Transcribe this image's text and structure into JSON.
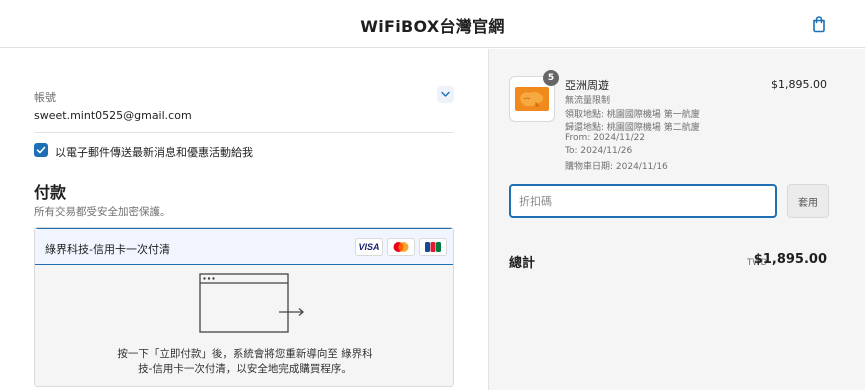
{
  "header": {
    "shop_title": "WiFiBOX台灣官網"
  },
  "account": {
    "label": "帳號",
    "email": "sweet.mint0525@gmail.com"
  },
  "marketing": {
    "checked": true,
    "label": "以電子郵件傳送最新消息和優惠活動給我"
  },
  "payment": {
    "title": "付款",
    "subtitle": "所有交易都受安全加密保護。",
    "option_label": "綠界科技-信用卡一次付清",
    "card_visa": "VISA",
    "redirect_text": "按一下「立即付款」後，系統會將您重新導向至 綠界科技-信用卡一次付清，以安全地完成購買程序。"
  },
  "order": {
    "quantity": "5",
    "product_name": "亞洲周遊",
    "lines": [
      "無流量限制",
      "領取地點: 桃園國際機場 第一航廈",
      "歸還地點: 桃園國際機場 第二航廈",
      "From: 2024/11/22",
      "To: 2024/11/26",
      "購物車日期: 2024/11/16"
    ],
    "price": "$1,895.00"
  },
  "discount": {
    "placeholder": "折扣碼",
    "apply_label": "套用"
  },
  "total": {
    "label": "總計",
    "currency": "TWD",
    "amount": "$1,895.00"
  },
  "colors": {
    "accent": "#1f6fb5",
    "summary_bg": "#f5f5f5",
    "product_thumb": "#f08a1c"
  },
  "icons": {
    "cart": "shopping-bag-icon",
    "chevron": "chevron-down-icon",
    "check": "check-icon",
    "redirect": "browser-redirect-icon"
  }
}
